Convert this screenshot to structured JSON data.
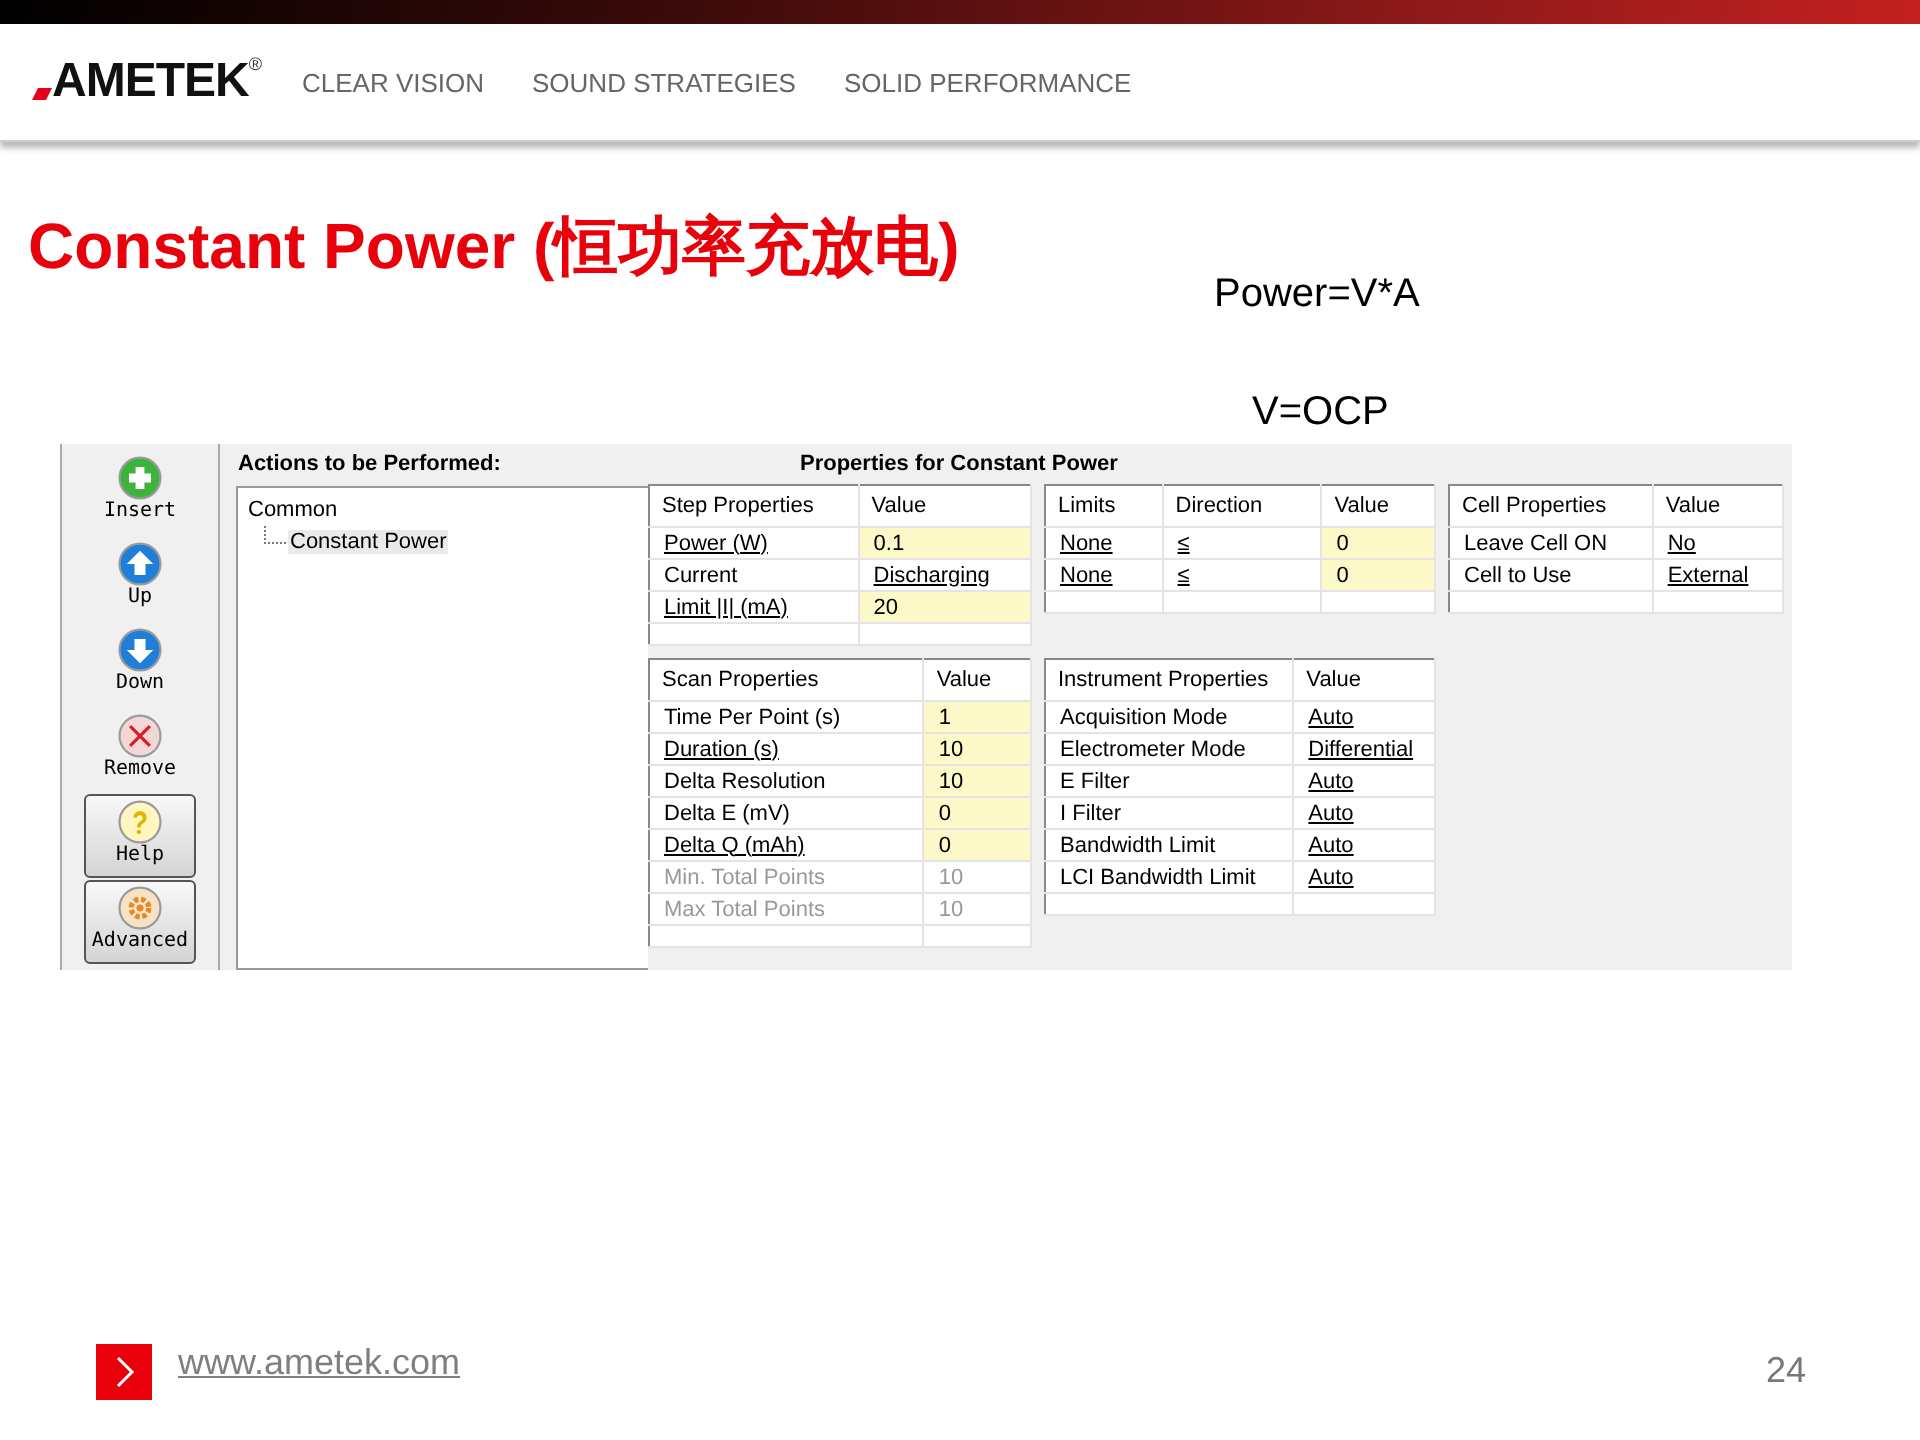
{
  "header": {
    "logo": "AMETEK",
    "logo_mark": "®",
    "taglines": [
      "CLEAR VISION",
      "SOUND STRATEGIES",
      "SOLID PERFORMANCE"
    ]
  },
  "title": "Constant Power (恒功率充放电)",
  "notes": [
    "Power=V*A",
    "V=OCP"
  ],
  "app": {
    "toolbar": [
      {
        "label": "Insert",
        "kind": "insert",
        "raised": false
      },
      {
        "label": "Up",
        "kind": "up",
        "raised": false
      },
      {
        "label": "Down",
        "kind": "down",
        "raised": false
      },
      {
        "label": "Remove",
        "kind": "remove",
        "raised": false
      },
      {
        "label": "Help",
        "kind": "help",
        "raised": true
      },
      {
        "label": "Advanced",
        "kind": "advanced",
        "raised": true
      }
    ],
    "actions_heading": "Actions to be Performed:",
    "tree": [
      {
        "label": "Common",
        "selected": false,
        "children": [
          {
            "label": "Constant Power",
            "selected": true
          }
        ]
      }
    ],
    "properties_heading": "Properties for Constant Power",
    "grids": [
      {
        "columns": [
          "Step Properties",
          "Value"
        ],
        "rows": [
          {
            "disabled": false,
            "cells": [
              {
                "text": "Power (W)",
                "underline": true,
                "highlight": false
              },
              {
                "text": "0.1",
                "underline": false,
                "highlight": true
              }
            ]
          },
          {
            "disabled": false,
            "cells": [
              {
                "text": "Current",
                "underline": false,
                "highlight": false
              },
              {
                "text": "Discharging",
                "underline": true,
                "highlight": false
              }
            ]
          },
          {
            "disabled": false,
            "cells": [
              {
                "text": "Limit |I| (mA)",
                "underline": true,
                "highlight": false
              },
              {
                "text": "20",
                "underline": false,
                "highlight": true
              }
            ]
          }
        ]
      },
      {
        "columns": [
          "Limits",
          "Direction",
          "Value"
        ],
        "rows": [
          {
            "disabled": false,
            "cells": [
              {
                "text": "None",
                "underline": true,
                "highlight": false
              },
              {
                "text": "≤",
                "underline": true,
                "highlight": false
              },
              {
                "text": "0",
                "underline": false,
                "highlight": true
              }
            ]
          },
          {
            "disabled": false,
            "cells": [
              {
                "text": "None",
                "underline": true,
                "highlight": false
              },
              {
                "text": "≤",
                "underline": true,
                "highlight": false
              },
              {
                "text": "0",
                "underline": false,
                "highlight": true
              }
            ]
          }
        ]
      },
      {
        "columns": [
          "Cell Properties",
          "Value"
        ],
        "rows": [
          {
            "disabled": false,
            "cells": [
              {
                "text": "Leave Cell ON",
                "underline": false,
                "highlight": false
              },
              {
                "text": "No",
                "underline": true,
                "highlight": false
              }
            ]
          },
          {
            "disabled": false,
            "cells": [
              {
                "text": "Cell to Use",
                "underline": false,
                "highlight": false
              },
              {
                "text": "External",
                "underline": true,
                "highlight": false
              }
            ]
          }
        ]
      },
      {
        "columns": [
          "Scan Properties",
          "Value"
        ],
        "rows": [
          {
            "disabled": false,
            "cells": [
              {
                "text": "Time Per Point (s)",
                "underline": false,
                "highlight": false
              },
              {
                "text": "1",
                "underline": false,
                "highlight": true
              }
            ]
          },
          {
            "disabled": false,
            "cells": [
              {
                "text": "Duration (s)",
                "underline": true,
                "highlight": false
              },
              {
                "text": "10",
                "underline": false,
                "highlight": true
              }
            ]
          },
          {
            "disabled": false,
            "cells": [
              {
                "text": "Delta Resolution",
                "underline": false,
                "highlight": false
              },
              {
                "text": "10",
                "underline": false,
                "highlight": true
              }
            ]
          },
          {
            "disabled": false,
            "cells": [
              {
                "text": "Delta E (mV)",
                "underline": false,
                "highlight": false
              },
              {
                "text": "0",
                "underline": false,
                "highlight": true
              }
            ]
          },
          {
            "disabled": false,
            "cells": [
              {
                "text": "Delta Q (mAh)",
                "underline": true,
                "highlight": false
              },
              {
                "text": "0",
                "underline": false,
                "highlight": true
              }
            ]
          },
          {
            "disabled": true,
            "cells": [
              {
                "text": "Min. Total Points",
                "underline": false,
                "highlight": false
              },
              {
                "text": "10",
                "underline": false,
                "highlight": false
              }
            ]
          },
          {
            "disabled": true,
            "cells": [
              {
                "text": "Max Total Points",
                "underline": false,
                "highlight": false
              },
              {
                "text": "10",
                "underline": false,
                "highlight": false
              }
            ]
          }
        ]
      },
      {
        "columns": [
          "Instrument Properties",
          "Value"
        ],
        "rows": [
          {
            "disabled": false,
            "cells": [
              {
                "text": "Acquisition Mode",
                "underline": false,
                "highlight": false
              },
              {
                "text": "Auto",
                "underline": true,
                "highlight": false
              }
            ]
          },
          {
            "disabled": false,
            "cells": [
              {
                "text": "Electrometer Mode",
                "underline": false,
                "highlight": false
              },
              {
                "text": "Differential",
                "underline": true,
                "highlight": false
              }
            ]
          },
          {
            "disabled": false,
            "cells": [
              {
                "text": "E Filter",
                "underline": false,
                "highlight": false
              },
              {
                "text": "Auto",
                "underline": true,
                "highlight": false
              }
            ]
          },
          {
            "disabled": false,
            "cells": [
              {
                "text": "I Filter",
                "underline": false,
                "highlight": false
              },
              {
                "text": "Auto",
                "underline": true,
                "highlight": false
              }
            ]
          },
          {
            "disabled": false,
            "cells": [
              {
                "text": "Bandwidth Limit",
                "underline": false,
                "highlight": false
              },
              {
                "text": "Auto",
                "underline": true,
                "highlight": false
              }
            ]
          },
          {
            "disabled": false,
            "cells": [
              {
                "text": "LCI Bandwidth Limit",
                "underline": false,
                "highlight": false
              },
              {
                "text": "Auto",
                "underline": true,
                "highlight": false
              }
            ]
          }
        ]
      }
    ]
  },
  "footer": {
    "link": "www.ametek.com",
    "page": "24"
  }
}
